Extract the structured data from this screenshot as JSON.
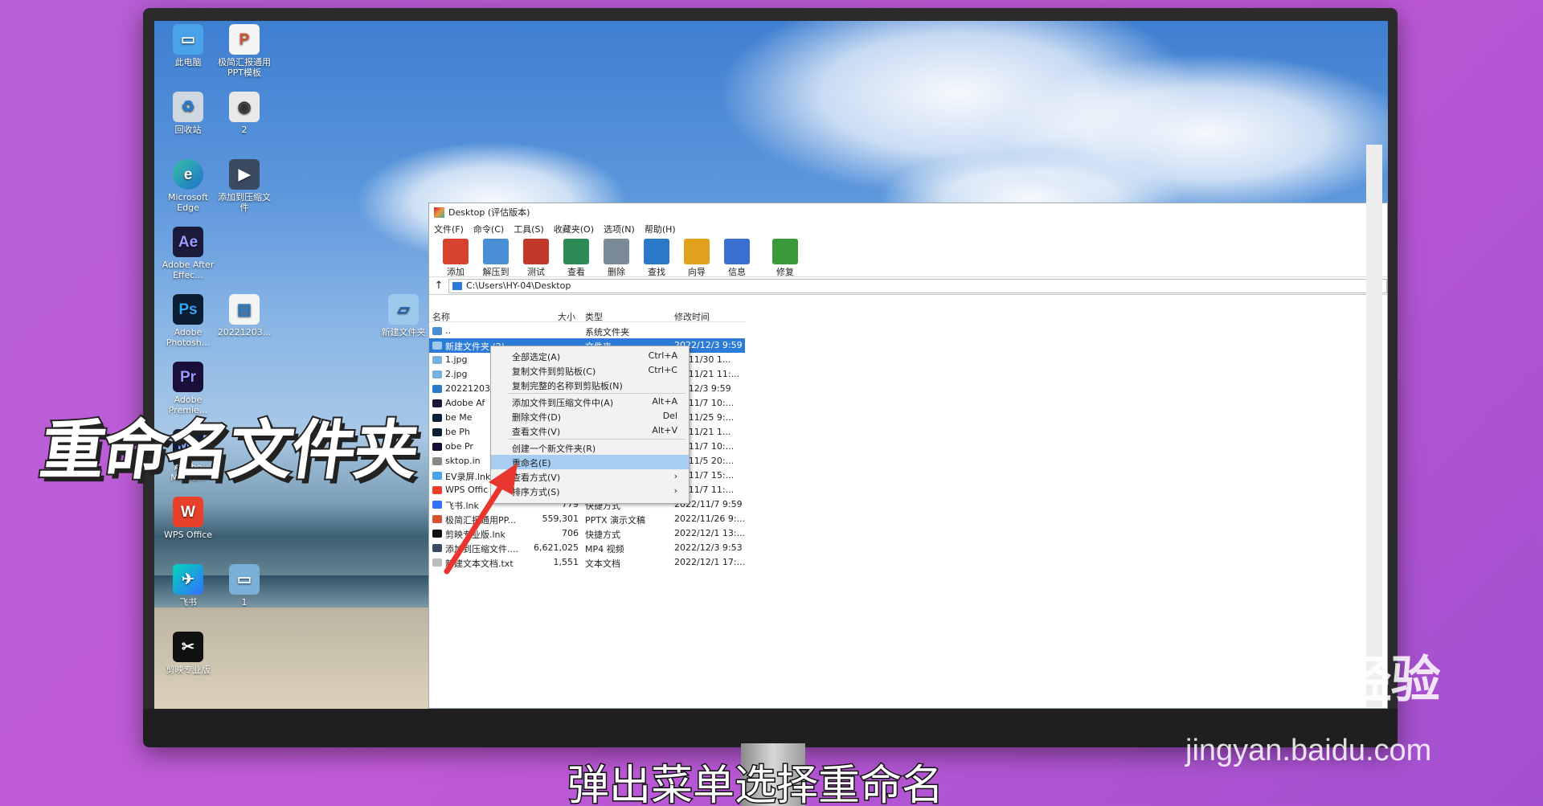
{
  "desktop": {
    "icons": [
      {
        "label": "此电脑"
      },
      {
        "label": "极简汇报通用PPT模板"
      },
      {
        "label": "回收站"
      },
      {
        "label": "2"
      },
      {
        "label": "Microsoft Edge"
      },
      {
        "label": "添加到压缩文件"
      },
      {
        "label": "Adobe After Effec..."
      },
      {
        "label": "Adobe Photosh..."
      },
      {
        "label": "20221203..."
      },
      {
        "label": "新建文件夹"
      },
      {
        "label": "Adobe Premie..."
      },
      {
        "label": "Adobe Media..."
      },
      {
        "label": "WPS Office"
      },
      {
        "label": "飞书"
      },
      {
        "label": "1"
      },
      {
        "label": "剪映专业版"
      }
    ]
  },
  "window": {
    "title": "Desktop (评估版本)",
    "menu": [
      "文件(F)",
      "命令(C)",
      "工具(S)",
      "收藏夹(O)",
      "选项(N)",
      "帮助(H)"
    ],
    "toolbar": [
      {
        "label": "添加",
        "color": "#d8432f"
      },
      {
        "label": "解压到",
        "color": "#4a8fd6"
      },
      {
        "label": "测试",
        "color": "#c0392b"
      },
      {
        "label": "查看",
        "color": "#2e8b57"
      },
      {
        "label": "删除",
        "color": "#7b8a99"
      },
      {
        "label": "查找",
        "color": "#2a78c8"
      },
      {
        "label": "向导",
        "color": "#e0a21a"
      },
      {
        "label": "信息",
        "color": "#3a6fd0"
      },
      {
        "label": "修复",
        "color": "#3a9a3a"
      }
    ],
    "path": "C:\\Users\\HY-04\\Desktop",
    "columns": {
      "name": "名称",
      "size": "大小",
      "type": "类型",
      "modified": "修改时间"
    },
    "files": [
      {
        "name": "..",
        "size": "",
        "type": "系统文件夹",
        "modified": ""
      },
      {
        "name": "新建文件夹 (2)",
        "size": "",
        "type": "文件夹",
        "modified": "2022/12/3 9:59"
      },
      {
        "name": "1.jpg",
        "size": "",
        "type": "",
        "modified": "22/11/30 1..."
      },
      {
        "name": "2.jpg",
        "size": "",
        "type": "",
        "modified": "22/11/21 11:..."
      },
      {
        "name": "20221203",
        "size": "",
        "type": "",
        "modified": "22/12/3 9:59"
      },
      {
        "name": "Adobe Af",
        "size": "",
        "type": "",
        "modified": "22/11/7 10:..."
      },
      {
        "name": "be Me",
        "size": "",
        "type": "",
        "modified": "22/11/25 9:..."
      },
      {
        "name": "be Ph",
        "size": "",
        "type": "",
        "modified": "22/11/21 1..."
      },
      {
        "name": "obe Pr",
        "size": "",
        "type": "",
        "modified": "22/11/7 10:..."
      },
      {
        "name": "sktop.in",
        "size": "",
        "type": "",
        "modified": "22/11/5 20:..."
      },
      {
        "name": "EV录屏.lnk",
        "size": "",
        "type": "",
        "modified": "22/11/7 15:..."
      },
      {
        "name": "WPS Offic",
        "size": "",
        "type": "",
        "modified": "22/11/7 11:..."
      },
      {
        "name": "飞书.lnk",
        "size": "779",
        "type": "快捷方式",
        "modified": "2022/11/7 9:59"
      },
      {
        "name": "极简汇报通用PP...",
        "size": "559,301",
        "type": "PPTX 演示文稿",
        "modified": "2022/11/26 9:..."
      },
      {
        "name": "剪映专业版.lnk",
        "size": "706",
        "type": "快捷方式",
        "modified": "2022/12/1 13:..."
      },
      {
        "name": "添加到压缩文件....",
        "size": "6,621,025",
        "type": "MP4 视频",
        "modified": "2022/12/3 9:53"
      },
      {
        "name": "新建文本文档.txt",
        "size": "1,551",
        "type": "文本文档",
        "modified": "2022/12/1 17:..."
      }
    ]
  },
  "context_menu": {
    "items": [
      {
        "label": "全部选定(A)",
        "key": "Ctrl+A"
      },
      {
        "label": "复制文件到剪贴板(C)",
        "key": "Ctrl+C"
      },
      {
        "label": "复制完整的名称到剪贴板(N)",
        "key": ""
      },
      {
        "label": "添加文件到压缩文件中(A)",
        "key": "Alt+A"
      },
      {
        "label": "删除文件(D)",
        "key": "Del"
      },
      {
        "label": "查看文件(V)",
        "key": "Alt+V"
      },
      {
        "label": "创建一个新文件夹(R)",
        "key": ""
      },
      {
        "label": "重命名(E)",
        "key": ""
      },
      {
        "label": "查看方式(V)",
        "key": "›"
      },
      {
        "label": "排序方式(S)",
        "key": "›"
      }
    ]
  },
  "overlay": {
    "title": "重命名文件夹",
    "subtitle": "弹出菜单选择重命名",
    "watermark_brand": "Bai du 经验",
    "watermark_url": "jingyan.baidu.com"
  }
}
